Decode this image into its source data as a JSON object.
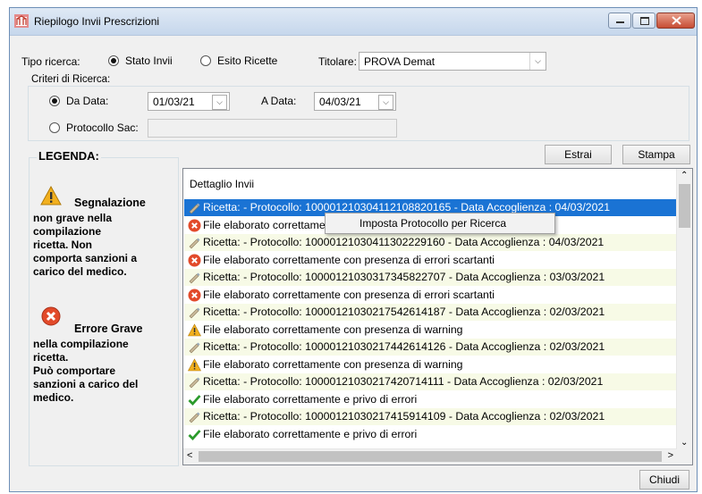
{
  "window": {
    "title": "Riepilogo Invii Prescrizioni"
  },
  "search": {
    "tipo_label": "Tipo ricerca:",
    "stato_invii": "Stato Invii",
    "esito_ricette": "Esito Ricette",
    "titolare_label": "Titolare:",
    "titolare_value": "PROVA Demat"
  },
  "criteri": {
    "title": "Criteri di Ricerca:",
    "da_data_label": "Da Data:",
    "da_data_value": "01/03/21",
    "a_data_label": "A Data:",
    "a_data_value": "04/03/21",
    "protocollo_label": "Protocollo Sac:",
    "protocollo_value": ""
  },
  "buttons": {
    "estrai": "Estrai",
    "stampa": "Stampa",
    "chiudi": "Chiudi"
  },
  "legenda": {
    "title": "LEGENDA:",
    "warning_title": "Segnalazione",
    "warning_lines": [
      "non grave nella",
      "compilazione",
      "ricetta. Non",
      "comporta sanzioni a",
      "carico del medico."
    ],
    "error_title": "Errore Grave",
    "error_lines": [
      "nella compilazione",
      "ricetta.",
      "Può comportare",
      "sanzioni a carico del",
      "medico."
    ]
  },
  "list": {
    "header": "Dettaglio Invii",
    "rows": [
      {
        "kind": "ricetta",
        "icon": "pencil-icon",
        "text": "Ricetta:  - Protocollo: 100001210304112108820165 - Data Accoglienza : 04/03/2021"
      },
      {
        "kind": "esito",
        "icon": "error-icon",
        "text": "File elaborato correttamente con presenza di errori scartanti"
      },
      {
        "kind": "ricetta",
        "icon": "pencil-icon",
        "text": "Ricetta:  - Protocollo: 100001210304113022291​60 - Data Accoglienza : 04/03/2021"
      },
      {
        "kind": "esito",
        "icon": "error-icon",
        "text": "File elaborato correttamente con presenza di errori scartanti"
      },
      {
        "kind": "ricetta",
        "icon": "pencil-icon",
        "text": "Ricetta:  - Protocollo: 100001210303173458227​07 - Data Accoglienza : 03/03/2021"
      },
      {
        "kind": "esito",
        "icon": "error-icon",
        "text": "File elaborato correttamente con presenza di errori scartanti"
      },
      {
        "kind": "ricetta",
        "icon": "pencil-icon",
        "text": "Ricetta:  - Protocollo: 100001210302175426141​87 - Data Accoglienza : 02/03/2021"
      },
      {
        "kind": "esito",
        "icon": "warning-icon",
        "text": "File elaborato correttamente con presenza di warning"
      },
      {
        "kind": "ricetta",
        "icon": "pencil-icon",
        "text": "Ricetta:  - Protocollo: 100001210302174426141​26 - Data Accoglienza : 02/03/2021"
      },
      {
        "kind": "esito",
        "icon": "warning-icon",
        "text": "File elaborato correttamente con presenza di warning"
      },
      {
        "kind": "ricetta",
        "icon": "pencil-icon",
        "text": "Ricetta:  - Protocollo: 100001210302174207141​11 - Data Accoglienza : 02/03/2021"
      },
      {
        "kind": "esito",
        "icon": "check-icon",
        "text": "File elaborato correttamente e privo di errori"
      },
      {
        "kind": "ricetta",
        "icon": "pencil-icon",
        "text": "Ricetta:  - Protocollo: 100001210302174159141​09 - Data Accoglienza : 02/03/2021"
      },
      {
        "kind": "esito",
        "icon": "check-icon",
        "text": "File elaborato correttamente e privo di errori"
      }
    ]
  },
  "context_menu": {
    "item": "Imposta Protocollo per Ricerca"
  },
  "colors": {
    "selection": "#1a73d4",
    "ricetta_row": "#f7fae6",
    "error": "#e24a2a",
    "warning": "#f2b01e",
    "check": "#2a9a2a"
  }
}
